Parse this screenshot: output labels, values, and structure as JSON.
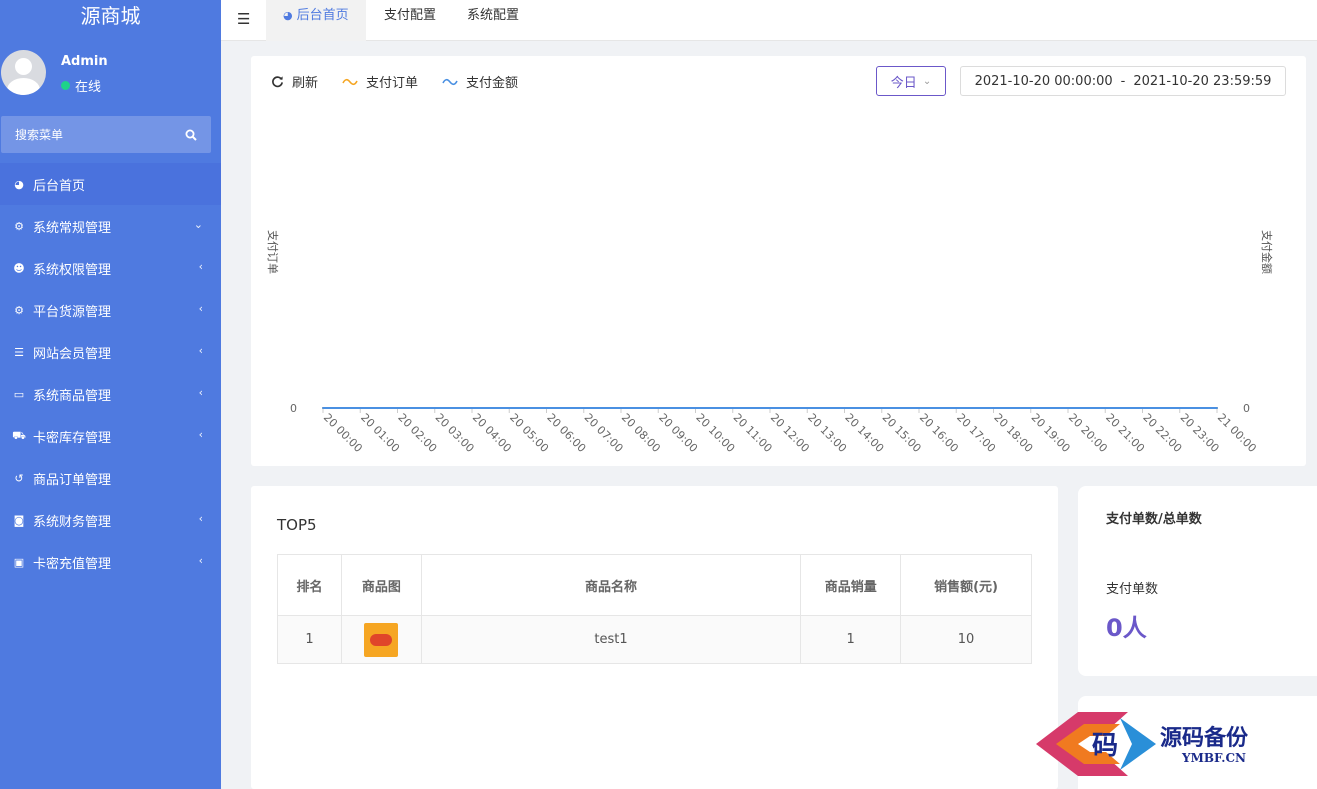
{
  "sidebar": {
    "brand": "源商城",
    "user": {
      "name": "Admin",
      "status": "在线"
    },
    "search_label": "搜索菜单",
    "items": [
      {
        "label": "后台首页",
        "icon": "dashboard-icon",
        "arrow": ""
      },
      {
        "label": "系统常规管理",
        "icon": "cogs-icon",
        "arrow": "⌄"
      },
      {
        "label": "系统权限管理",
        "icon": "users-icon",
        "arrow": "‹"
      },
      {
        "label": "平台货源管理",
        "icon": "cogs-icon",
        "arrow": "‹"
      },
      {
        "label": "网站会员管理",
        "icon": "list-icon",
        "arrow": "‹"
      },
      {
        "label": "系统商品管理",
        "icon": "jcb-card-icon",
        "arrow": "‹"
      },
      {
        "label": "卡密库存管理",
        "icon": "cart-icon",
        "arrow": "‹"
      },
      {
        "label": "商品订单管理",
        "icon": "history-icon",
        "arrow": ""
      },
      {
        "label": "系统财务管理",
        "icon": "binoculars-icon",
        "arrow": "‹"
      },
      {
        "label": "卡密充值管理",
        "icon": "money-icon",
        "arrow": "‹"
      }
    ]
  },
  "topbar": {
    "tabs": [
      {
        "label": "后台首页"
      },
      {
        "label": "支付配置"
      },
      {
        "label": "系统配置"
      }
    ]
  },
  "toolbar": {
    "refresh": "刷新",
    "legend_orders": "支付订单",
    "legend_amount": "支付金额",
    "period": "今日",
    "date_start": "2021-10-20 00:00:00",
    "date_sep": "-",
    "date_end": "2021-10-20 23:59:59"
  },
  "chart_data": {
    "type": "line",
    "title": "",
    "ylabel_left": "支付订单",
    "ylabel_right": "支付金额",
    "x": [
      "20 00:00",
      "20 01:00",
      "20 02:00",
      "20 03:00",
      "20 04:00",
      "20 05:00",
      "20 06:00",
      "20 07:00",
      "20 08:00",
      "20 09:00",
      "20 10:00",
      "20 11:00",
      "20 12:00",
      "20 13:00",
      "20 14:00",
      "20 15:00",
      "20 16:00",
      "20 17:00",
      "20 18:00",
      "20 19:00",
      "20 20:00",
      "20 21:00",
      "20 22:00",
      "20 23:00",
      "21 00:00"
    ],
    "y_left_ticks": [
      "0"
    ],
    "y_right_ticks": [
      "0"
    ],
    "series": [
      {
        "name": "支付订单",
        "color": "#f5a623",
        "values": [
          0,
          0,
          0,
          0,
          0,
          0,
          0,
          0,
          0,
          0,
          0,
          0,
          0,
          0,
          0,
          0,
          0,
          0,
          0,
          0,
          0,
          0,
          0,
          0,
          0
        ]
      },
      {
        "name": "支付金额",
        "color": "#4a90e2",
        "values": [
          0,
          0,
          0,
          0,
          0,
          0,
          0,
          0,
          0,
          0,
          0,
          0,
          0,
          0,
          0,
          0,
          0,
          0,
          0,
          0,
          0,
          0,
          0,
          0,
          0
        ]
      }
    ]
  },
  "top5": {
    "title": "TOP5",
    "headers": [
      "排名",
      "商品图",
      "商品名称",
      "商品销量",
      "销售额(元)"
    ],
    "rows": [
      {
        "rank": "1",
        "name": "test1",
        "sales": "1",
        "amount": "10"
      }
    ]
  },
  "stats": {
    "title": "支付单数/总单数",
    "label": "支付单数",
    "value": "0人"
  },
  "watermark": {
    "logo_char": "码",
    "text": "源码备份",
    "url": "YMBF.CN"
  },
  "colors": {
    "sidebar": "#4f7ae0",
    "accent": "#6b58c9",
    "online": "#1ed38a"
  }
}
